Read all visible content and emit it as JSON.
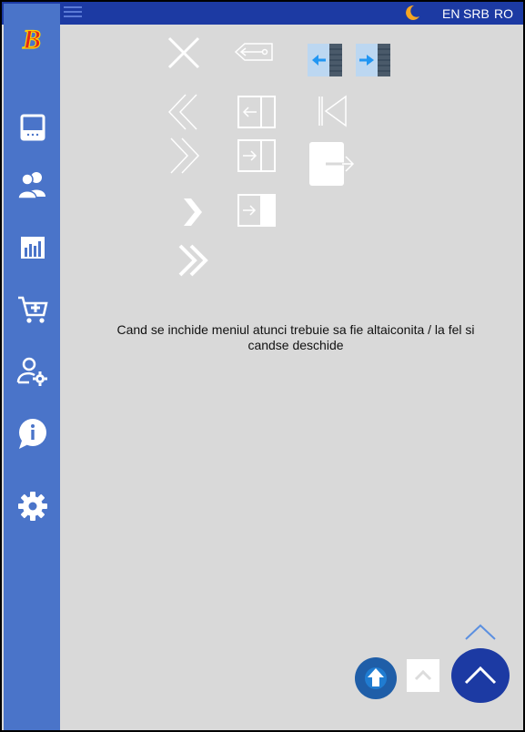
{
  "topbar": {
    "languages": [
      "EN",
      "SRB",
      "RO"
    ],
    "theme_icon": "moon-icon",
    "menu_icon": "hamburger-icon"
  },
  "sidebar": {
    "logo": "B",
    "items": [
      {
        "icon": "dashboard-icon"
      },
      {
        "icon": "users-icon"
      },
      {
        "icon": "bar-chart-icon"
      },
      {
        "icon": "add-to-cart-icon"
      },
      {
        "icon": "user-settings-icon"
      },
      {
        "icon": "info-icon"
      },
      {
        "icon": "gear-icon"
      }
    ]
  },
  "main": {
    "note": "Cand se inchide meniul atunci trebuie sa fie altaiconita / la fel si candse deschide"
  },
  "colors": {
    "topbar": "#1c3aa3",
    "sidebar": "#4a74c9",
    "background": "#d9d9d9",
    "moon": "#f5a623",
    "logo": "#e3261b",
    "accent_blue": "#2196f3"
  }
}
